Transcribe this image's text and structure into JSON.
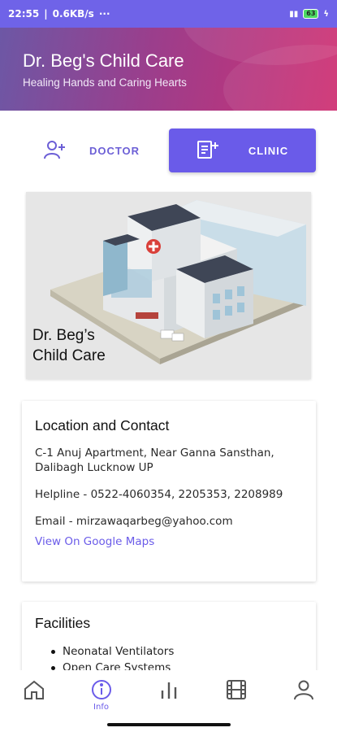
{
  "status_bar": {
    "time": "22:55",
    "speed": "0.6KB/s",
    "more": "···",
    "battery": "63"
  },
  "header": {
    "title": "Dr. Beg's Child Care",
    "subtitle": "Healing Hands and Caring Hearts"
  },
  "toggle": {
    "doctor_label": "DOCTOR",
    "clinic_label": "CLINIC",
    "active": "clinic"
  },
  "clinic_image": {
    "caption_line1": "Dr. Beg’s",
    "caption_line2": "Child Care"
  },
  "location_card": {
    "heading": "Location and Contact",
    "address": "C-1 Anuj Apartment, Near Ganna Sansthan, Dalibagh Lucknow UP",
    "helpline": "Helpline - 0522-4060354, 2205353, 2208989",
    "email": "Email - mirzawaqarbeg@yahoo.com",
    "map_link": "View On Google Maps"
  },
  "facilities_card": {
    "heading": "Facilities",
    "items": [
      "Neonatal Ventilators",
      "Open Care Systems"
    ]
  },
  "bottom_nav": {
    "items": [
      {
        "icon": "home-icon",
        "label": ""
      },
      {
        "icon": "info-icon",
        "label": "Info"
      },
      {
        "icon": "chart-icon",
        "label": ""
      },
      {
        "icon": "film-icon",
        "label": ""
      },
      {
        "icon": "person-icon",
        "label": ""
      }
    ],
    "active_index": 1
  },
  "colors": {
    "accent": "#6a5be9",
    "header_start": "#6b58a6",
    "header_end": "#cf2f72"
  }
}
